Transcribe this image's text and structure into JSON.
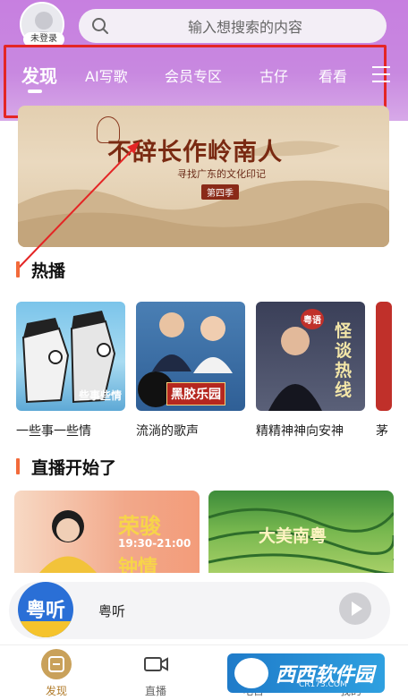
{
  "header": {
    "avatar_label": "未登录",
    "search_placeholder": "输入想搜索的内容"
  },
  "tabs": [
    {
      "label": "发现",
      "active": true
    },
    {
      "label": "AI写歌"
    },
    {
      "label": "会员专区"
    },
    {
      "label": "古仔"
    },
    {
      "label": "看看"
    }
  ],
  "banner": {
    "title": "不辞长作岭南人",
    "subtitle": "寻找广东的文化印记",
    "season": "第四季"
  },
  "hot": {
    "heading": "热播",
    "items": [
      {
        "label": "一些事一些情",
        "cover_text": "些事些情"
      },
      {
        "label": "流淌的歌声",
        "cover_text": "黑胶乐园"
      },
      {
        "label": "精精神神向安神",
        "cover_text": "怪谈热线"
      },
      {
        "label": "茅"
      }
    ]
  },
  "live": {
    "heading": "直播开始了",
    "items": [
      {
        "cover_text": "荣骏",
        "time": "19:30-21:00",
        "extra": "钟情"
      },
      {
        "cover_text": "大美南粤"
      }
    ]
  },
  "player": {
    "logo_text": "粤听",
    "title": "粤听"
  },
  "bottom_nav": [
    {
      "label": "发现",
      "icon": "discover-icon",
      "active": true
    },
    {
      "label": "直播",
      "icon": "video-icon"
    },
    {
      "label": "电台",
      "icon": "radio-icon"
    },
    {
      "label": "我的",
      "icon": "user-icon"
    }
  ],
  "watermark": {
    "text": "西西软件园",
    "sub": "CR173.COM"
  },
  "colors": {
    "header": "#c77fe0",
    "accent": "#f26a3a",
    "highlight_box": "#e42525"
  }
}
